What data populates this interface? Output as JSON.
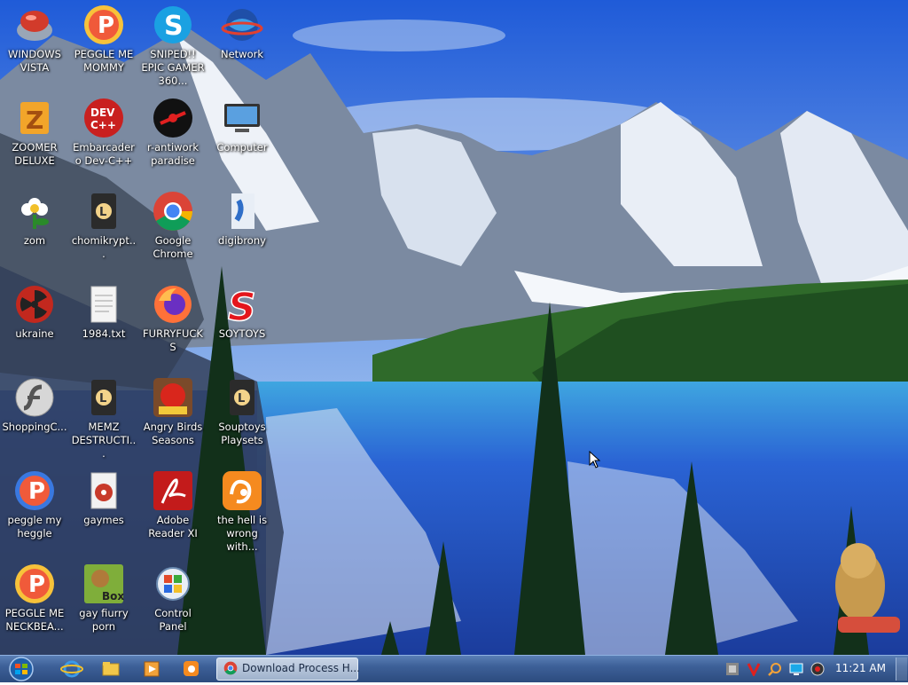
{
  "desktop": {
    "icons": [
      {
        "label": "WINDOWS VISTA",
        "icon": "vista-app-icon"
      },
      {
        "label": "PEGGLE ME MOMMY",
        "icon": "peggle-icon"
      },
      {
        "label": "SNIPED!! EPIC GAMER 360...",
        "icon": "skype-icon"
      },
      {
        "label": "Network",
        "icon": "network-globe-icon"
      },
      {
        "label": "ZOOMER DELUXE",
        "icon": "zoomer-icon"
      },
      {
        "label": "Embarcadero Dev-C++",
        "icon": "devcpp-icon"
      },
      {
        "label": "r-antiwork paradise",
        "icon": "antiwork-icon"
      },
      {
        "label": "Computer",
        "icon": "computer-icon"
      },
      {
        "label": "zom",
        "icon": "flower-icon"
      },
      {
        "label": "chomikrypt...",
        "icon": "shortcut-file-icon"
      },
      {
        "label": "Google Chrome",
        "icon": "chrome-icon"
      },
      {
        "label": "digibrony",
        "icon": "digibrony-icon"
      },
      {
        "label": "ukraine",
        "icon": "radiation-icon"
      },
      {
        "label": "1984.txt",
        "icon": "text-file-icon"
      },
      {
        "label": "FURRYFUCKS",
        "icon": "firefox-icon"
      },
      {
        "label": "SOYTOYS",
        "icon": "soytoys-icon"
      },
      {
        "label": "ShoppingC...",
        "icon": "flash-icon"
      },
      {
        "label": "MEMZ DESTRUCTI...",
        "icon": "shortcut-file-icon"
      },
      {
        "label": "Angry Birds Seasons",
        "icon": "angry-birds-icon"
      },
      {
        "label": "Souptoys Playsets",
        "icon": "shortcut-file-icon"
      },
      {
        "label": "peggle my heggle",
        "icon": "peggle-icon"
      },
      {
        "label": "gaymes",
        "icon": "media-file-icon"
      },
      {
        "label": "Adobe Reader XI",
        "icon": "adobe-reader-icon"
      },
      {
        "label": "the hell is wrong with...",
        "icon": "uc-browser-icon"
      },
      {
        "label": "PEGGLE ME NECKBEA...",
        "icon": "peggle-icon"
      },
      {
        "label": "gay fiurry porn",
        "icon": "bonzi-box-icon"
      },
      {
        "label": "Control Panel",
        "icon": "control-panel-icon"
      }
    ]
  },
  "taskbar": {
    "start_icon": "windows-orb-icon",
    "pinned": [
      {
        "icon": "internet-explorer-icon"
      },
      {
        "icon": "folder-icon"
      },
      {
        "icon": "media-player-icon"
      },
      {
        "icon": "uc-browser-icon"
      }
    ],
    "active_window": {
      "title": "Download Process H...",
      "icon": "chrome-icon"
    },
    "tray": {
      "icons": [
        "tray-app-icon",
        "tray-v-icon",
        "tray-search-icon",
        "tray-display-icon",
        "tray-volume-icon"
      ],
      "clock": "11:21 AM"
    }
  }
}
